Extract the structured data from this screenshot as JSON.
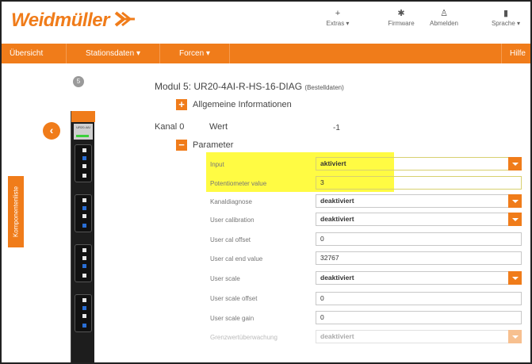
{
  "header": {
    "brand": "Weidmüller",
    "links": [
      {
        "label": "Extras",
        "icon": "plus-icon",
        "has_menu": true
      },
      {
        "label": "Firmware",
        "icon": "gear-icon",
        "has_menu": false
      },
      {
        "label": "Abmelden",
        "icon": "user-icon",
        "has_menu": false
      },
      {
        "label": "Sprache",
        "icon": "speech-bubble-icon",
        "has_menu": true
      }
    ]
  },
  "nav": {
    "items": [
      {
        "label": "Übersicht"
      },
      {
        "label": "Stationsdaten ▾"
      },
      {
        "label": "Forcen ▾"
      }
    ],
    "help": "Hilfe"
  },
  "sidebar": {
    "tab_label": "Komponentenliste",
    "module_number": "5",
    "device_label": "UR20-4AI"
  },
  "module": {
    "title": "Modul 5: UR20-4AI-R-HS-16-DIAG",
    "order_data": "(Bestelldaten)",
    "general_info": "Allgemeine Informationen",
    "channel": "Kanal 0",
    "value_label": "Wert",
    "value": "-1",
    "parameter_label": "Parameter"
  },
  "parameters": [
    {
      "label": "Input",
      "value": "aktiviert",
      "type": "select"
    },
    {
      "label": "Potentiometer value",
      "value": "3",
      "type": "text"
    },
    {
      "label": "Kanaldiagnose",
      "value": "deaktiviert",
      "type": "select"
    },
    {
      "label": "User calibration",
      "value": "deaktiviert",
      "type": "select"
    },
    {
      "label": "User cal offset",
      "value": "0",
      "type": "text"
    },
    {
      "label": "User cal end value",
      "value": "32767",
      "type": "text"
    },
    {
      "label": "User scale",
      "value": "deaktiviert",
      "type": "select"
    },
    {
      "label": "User scale offset",
      "value": "0",
      "type": "text"
    },
    {
      "label": "User scale gain",
      "value": "0",
      "type": "text"
    },
    {
      "label": "Grenzwertüberwachung",
      "value": "deaktiviert",
      "type": "select",
      "disabled": true
    }
  ],
  "colors": {
    "accent": "#f07c1a",
    "highlight": "#fffb43"
  }
}
